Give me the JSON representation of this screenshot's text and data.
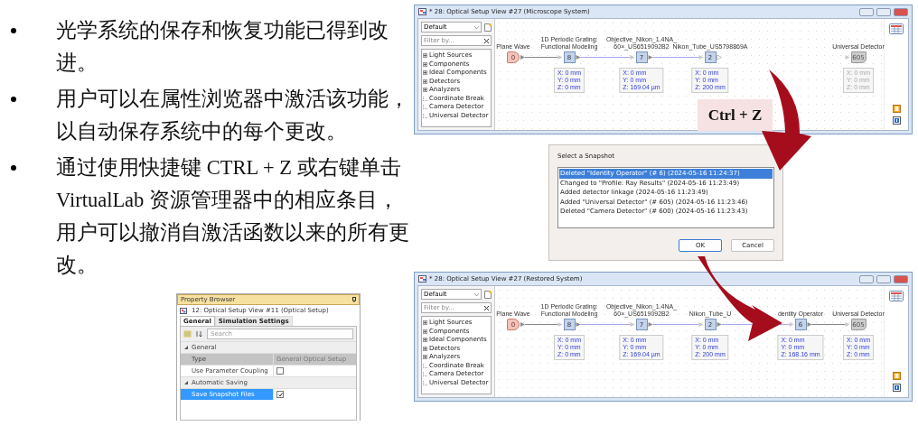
{
  "bullets": [
    "光学系统的保存和恢复功能已得到改进。",
    "用户可以在属性浏览器中激活该功能，以自动保存系统中的每个更改。",
    "通过使用快捷键 CTRL + Z 或右键单击 VirtualLab 资源管理器中的相应条目，用户可以撤消自激活函数以来的所有更改。"
  ],
  "property_browser": {
    "title": "Property Browser",
    "document": "12: Optical Setup View #11 (Optical Setup)",
    "tabs": [
      {
        "label": "General",
        "selected": true
      },
      {
        "label": "Simulation Settings",
        "selected": false
      }
    ],
    "search": {
      "placeholder": "Search"
    },
    "groups": [
      {
        "name": "General",
        "expanded": true,
        "rows": [
          {
            "name": "Type",
            "kind": "text",
            "value": "General Optical Setup",
            "read_only": true,
            "selected": false
          },
          {
            "name": "Use Parameter Coupling",
            "kind": "checkbox",
            "checked": false,
            "read_only": false,
            "selected": false
          }
        ]
      },
      {
        "name": "Automatic Saving",
        "expanded": true,
        "rows": [
          {
            "name": "Save Snapshot Files",
            "kind": "checkbox",
            "checked": true,
            "read_only": false,
            "selected": true
          }
        ]
      }
    ]
  },
  "windows": [
    {
      "title": "* 28: Optical Setup View #27 (Microscope System)",
      "view": "Default",
      "filter_placeholder": "Filter by...",
      "tree": [
        {
          "label": "Light Sources",
          "expandable": true
        },
        {
          "label": "Components",
          "expandable": true
        },
        {
          "label": "Ideal Components",
          "expandable": true
        },
        {
          "label": "Detectors",
          "expandable": true
        },
        {
          "label": "Analyzers",
          "expandable": true
        },
        {
          "label": "Coordinate Break",
          "expandable": false
        },
        {
          "label": "Camera Detector",
          "expandable": false
        },
        {
          "label": "Universal Detector",
          "expandable": false
        }
      ],
      "nodes": [
        {
          "label": [
            "Plane Wave"
          ],
          "kind": "source",
          "id": "0",
          "linked": true
        },
        {
          "label": [
            "1D Periodic Grating:",
            "Functional Modeling"
          ],
          "kind": "component",
          "id": "8",
          "linked": true,
          "position": [
            "X: 0 mm",
            "Y: 0 mm",
            "Z: 0 mm"
          ],
          "dimmed": false
        },
        {
          "label": [
            "Objective_Nikon_1.4NA_",
            "60×_US6519092B2"
          ],
          "kind": "component",
          "id": "7",
          "linked": true,
          "position": [
            "X: 0 mm",
            "Y: 0 mm",
            "Z: 169.04 µm"
          ],
          "dimmed": false
        },
        {
          "label": [
            "Nikon_Tube_US5798869A"
          ],
          "kind": "component",
          "id": "2",
          "linked": false,
          "position": [
            "X: 0 mm",
            "Y: 0 mm",
            "Z: 200 mm"
          ],
          "dimmed": false
        },
        {
          "label": [
            "Universal Detector"
          ],
          "kind": "detector",
          "id": "605",
          "position": [
            "X: 0 mm",
            "Y: 0 mm",
            "Z: 0 mm"
          ],
          "dimmed": true
        }
      ]
    },
    {
      "title": "* 28: Optical Setup View #27 (Restored System)",
      "view": "Default",
      "filter_placeholder": "Filter by...",
      "tree": [
        {
          "label": "Light Sources",
          "expandable": true
        },
        {
          "label": "Components",
          "expandable": true
        },
        {
          "label": "Ideal Components",
          "expandable": true
        },
        {
          "label": "Detectors",
          "expandable": true
        },
        {
          "label": "Analyzers",
          "expandable": true
        },
        {
          "label": "Coordinate Break",
          "expandable": false
        },
        {
          "label": "Camera Detector",
          "expandable": false
        },
        {
          "label": "Universal Detector",
          "expandable": false
        }
      ],
      "nodes": [
        {
          "label": [
            "Plane Wave"
          ],
          "kind": "source",
          "id": "0",
          "linked": true
        },
        {
          "label": [
            "1D Periodic Grating:",
            "Functional Modeling"
          ],
          "kind": "component",
          "id": "8",
          "linked": true,
          "position": [
            "X: 0 mm",
            "Y: 0 mm",
            "Z: 0 mm"
          ],
          "dimmed": false
        },
        {
          "label": [
            "Objective_Nikon_1.4NA_",
            "60×_US6519092B2"
          ],
          "kind": "component",
          "id": "7",
          "linked": true,
          "position": [
            "X: 0 mm",
            "Y: 0 mm",
            "Z: 169.04 µm"
          ],
          "dimmed": false
        },
        {
          "label": [
            "Nikon_Tube_U"
          ],
          "kind": "component",
          "id": "2",
          "linked": true,
          "position": [
            "X: 0 mm",
            "Y: 0 mm",
            "Z: 200 mm"
          ],
          "dimmed": false
        },
        {
          "label": [
            "dentity Operator"
          ],
          "kind": "component",
          "id": "6",
          "linked": true,
          "position": [
            "X: 0 mm",
            "Y: 0 mm",
            "Z: 168.16 mm"
          ],
          "dimmed": false
        },
        {
          "label": [
            "Universal Detector"
          ],
          "kind": "detector",
          "id": "605",
          "position": [
            "X: 0 mm",
            "Y: 0 mm",
            "Z: 0 mm"
          ],
          "dimmed": false
        }
      ]
    }
  ],
  "dialog": {
    "title": "Select a Snapshot",
    "items": [
      {
        "text": "Deleted \"Identity Operator\" (# 6) (2024-05-16 11:24:37)",
        "selected": true
      },
      {
        "text": "Changed to \"Profile: Ray Results\" (2024-05-16 11:23:49)",
        "selected": false
      },
      {
        "text": "Added detector linkage (2024-05-16 11:23:49)",
        "selected": false
      },
      {
        "text": "Added \"Universal Detector\" (# 605) (2024-05-16 11:23:46)",
        "selected": false
      },
      {
        "text": "Deleted \"Camera Detector\" (# 600) (2024-05-16 11:23:43)",
        "selected": false
      }
    ],
    "buttons": [
      {
        "label": "OK",
        "default": true
      },
      {
        "label": "Cancel",
        "default": false
      }
    ]
  },
  "callout": "Ctrl + Z"
}
